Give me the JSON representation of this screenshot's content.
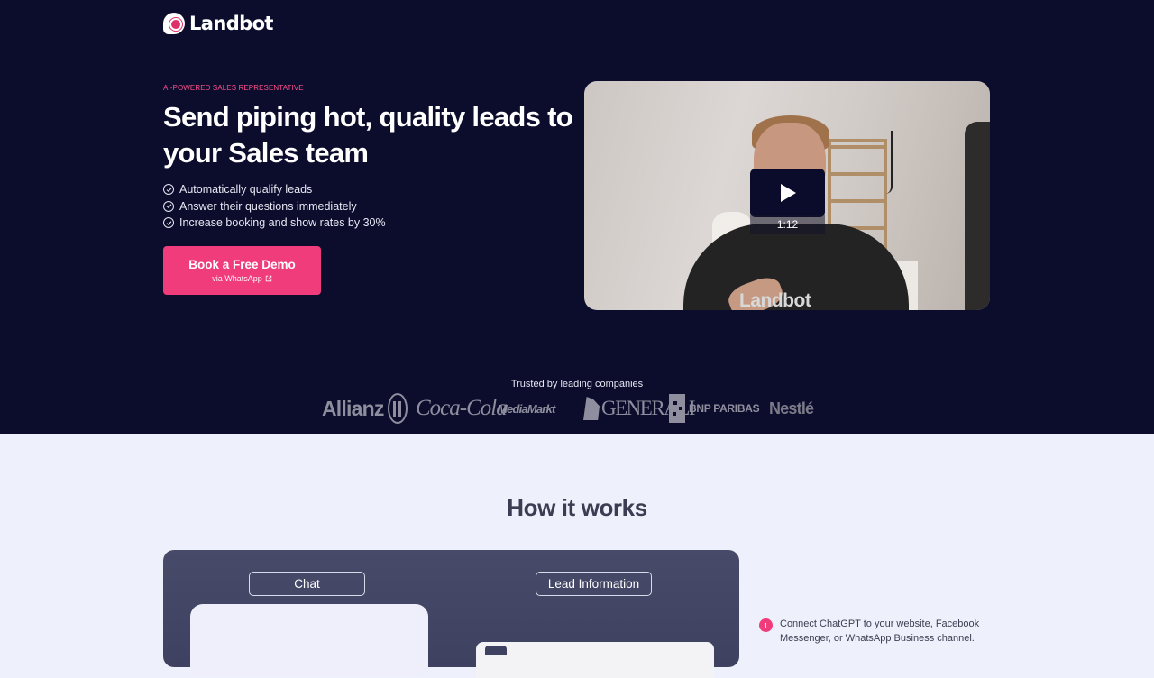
{
  "brand": {
    "name": "Landbot",
    "accent": "#f03c7a",
    "hero_bg": "#0c0c2c"
  },
  "hero": {
    "eyebrow": "AI-POWERED SALES REPRESENTATIVE",
    "headline": "Send piping hot, quality leads to your Sales team",
    "features": [
      "Automatically qualify leads",
      "Answer their questions immediately",
      "Increase booking and show rates by 30%"
    ],
    "cta": {
      "label": "Book a Free Demo",
      "sublabel": "via WhatsApp",
      "icon": "external-link-icon"
    }
  },
  "video": {
    "duration": "1:12",
    "shirt_text": "Landbot",
    "icon": "play-icon"
  },
  "trusted": {
    "label": "Trusted by leading companies",
    "companies": [
      "Allianz",
      "Coca-Cola",
      "MediaMarkt",
      "GENERALI",
      "BNP PARIBAS",
      "Nestlé"
    ]
  },
  "how_it_works": {
    "title": "How it works",
    "tabs": [
      "Chat",
      "Lead Information"
    ],
    "steps": [
      {
        "number": "1",
        "text": "Connect ChatGPT to your website, Facebook Messenger, or WhatsApp Business channel."
      }
    ]
  }
}
